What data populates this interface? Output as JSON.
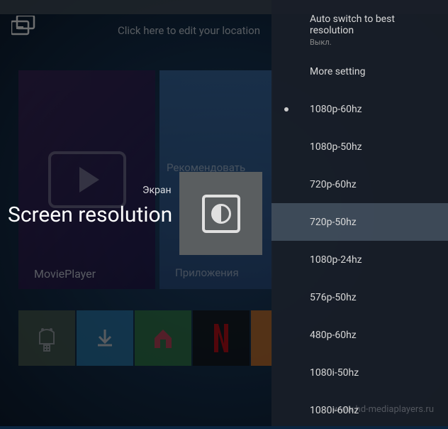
{
  "header": {
    "location_text": "Click here to edit your location"
  },
  "tiles": {
    "movieplayer": {
      "label": "MoviePlayer"
    },
    "recommend": {
      "label": "Рекомендовать",
      "label2": "Приложения"
    }
  },
  "screen_label": "Экран",
  "main_title": "Screen resolution",
  "panel": {
    "auto_switch": {
      "label": "Auto switch to best resolution",
      "sub": "Выкл."
    },
    "more_setting": {
      "label": "More setting"
    },
    "items": [
      {
        "label": "1080p-60hz",
        "current": true
      },
      {
        "label": "1080p-50hz",
        "current": false
      },
      {
        "label": "720p-60hz",
        "current": false
      },
      {
        "label": "720p-50hz",
        "current": false,
        "selected": true
      },
      {
        "label": "1080p-24hz",
        "current": false
      },
      {
        "label": "576p-50hz",
        "current": false
      },
      {
        "label": "480p-60hz",
        "current": false
      },
      {
        "label": "1080i-50hz",
        "current": false
      },
      {
        "label": "1080i-60hz",
        "current": false
      }
    ]
  },
  "watermark": "www.hd-mediaplayers.ru"
}
